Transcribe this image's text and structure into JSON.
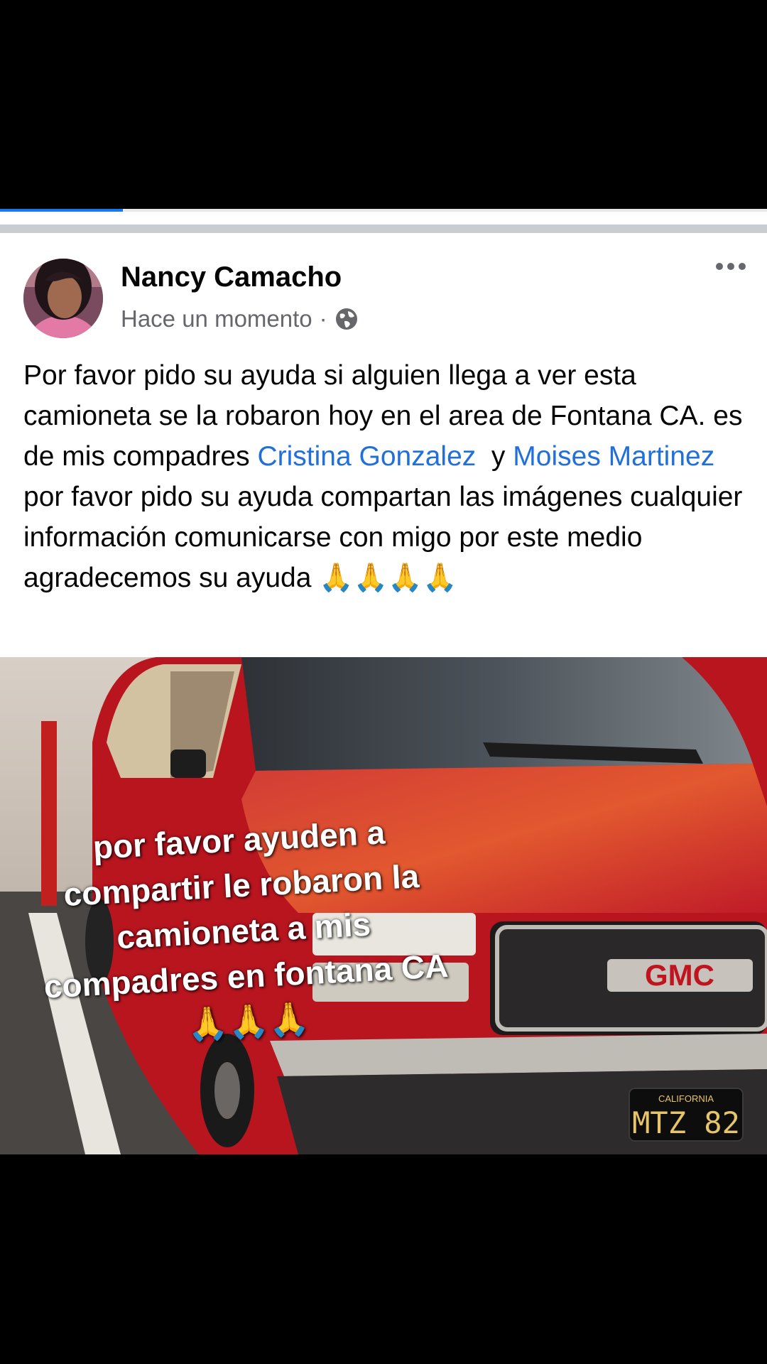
{
  "progress": {
    "fraction": 0.16
  },
  "post": {
    "author": "Nancy Camacho",
    "timestamp": "Hace un momento",
    "separator": "·",
    "privacy_icon": "globe-icon",
    "more_icon": "more-horizontal-icon",
    "text_part1": "Por favor pido su ayuda si alguien llega a ver esta camioneta se la robaron hoy en el area de Fontana CA. es de mis compadres ",
    "mention1": "Cristina Gonzalez",
    "text_part2": "  y ",
    "mention2": "Moises Martinez",
    "text_part3": "  por favor pido su ayuda compartan las imágenes cualquier información comunicarse con migo por este medio agradecemos su ayuda ",
    "text_emoji": "🙏🙏🙏🙏"
  },
  "photo": {
    "caption_line1": "por favor ayuden a",
    "caption_line2": "compartir le robaron la",
    "caption_line3": "camioneta a mis",
    "caption_line4": "compadres en fontana CA",
    "caption_emoji": "🙏🙏🙏",
    "brand_badge": "GMC",
    "plate_state": "CALIFORNIA",
    "plate_number": "MTZ 82"
  },
  "colors": {
    "accent": "#1877f2",
    "mention": "#216fdb",
    "truck_red": "#c3152a"
  }
}
